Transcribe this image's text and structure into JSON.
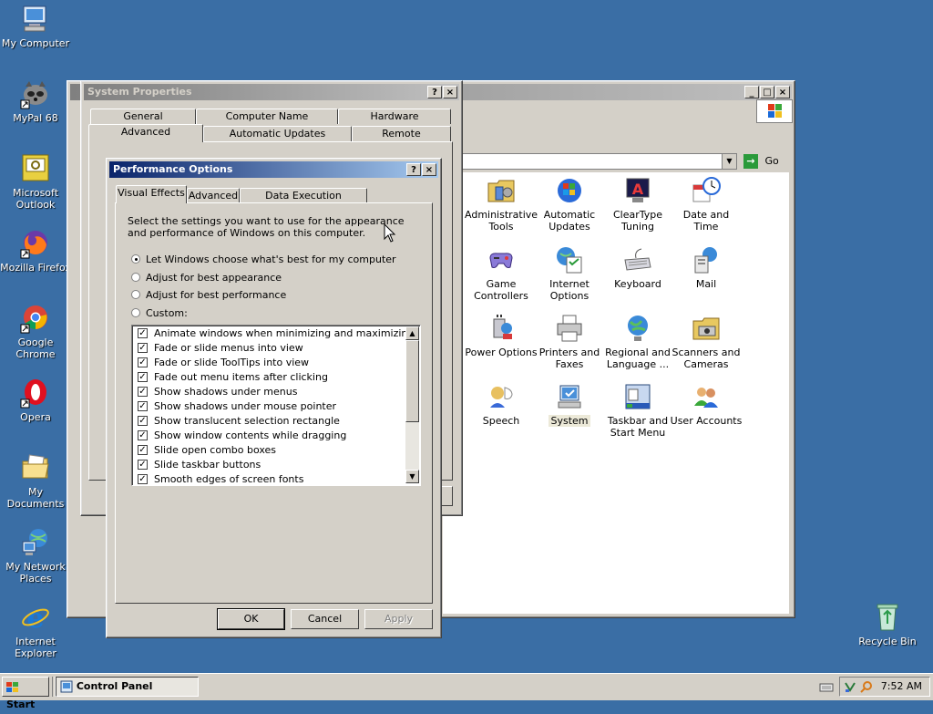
{
  "desktop": {
    "icons": [
      {
        "label": "My Computer"
      },
      {
        "label": "MyPal 68"
      },
      {
        "label": "Microsoft Outlook"
      },
      {
        "label": "Mozilla Firefox"
      },
      {
        "label": "Google Chrome"
      },
      {
        "label": "Opera"
      },
      {
        "label": "My Documents"
      },
      {
        "label": "My Network Places"
      },
      {
        "label": "Internet Explorer"
      },
      {
        "label": "Recycle Bin"
      }
    ]
  },
  "control_panel": {
    "title": "Control Panel",
    "go_label": "Go",
    "items": [
      {
        "label": "Administrative Tools",
        "icon": "admin-tools-icon"
      },
      {
        "label": "Automatic Updates",
        "icon": "auto-updates-icon"
      },
      {
        "label": "ClearType Tuning",
        "icon": "cleartype-icon"
      },
      {
        "label": "Date and Time",
        "icon": "clock-icon"
      },
      {
        "label": "Game Controllers",
        "icon": "gamepad-icon"
      },
      {
        "label": "Internet Options",
        "icon": "internet-options-icon"
      },
      {
        "label": "Keyboard",
        "icon": "keyboard-icon"
      },
      {
        "label": "Mail",
        "icon": "mail-icon"
      },
      {
        "label": "Power Options",
        "icon": "power-icon"
      },
      {
        "label": "Printers and Faxes",
        "icon": "printer-icon"
      },
      {
        "label": "Regional and Language ...",
        "icon": "globe-icon"
      },
      {
        "label": "Scanners and Cameras",
        "icon": "scanner-icon"
      },
      {
        "label": "Speech",
        "icon": "speech-icon"
      },
      {
        "label": "System",
        "icon": "system-icon"
      },
      {
        "label": "Taskbar and Start Menu",
        "icon": "taskbar-icon"
      },
      {
        "label": "User Accounts",
        "icon": "users-icon"
      }
    ]
  },
  "system_properties": {
    "title": "System Properties",
    "tabs_row1": [
      "General",
      "Computer Name",
      "Hardware"
    ],
    "tabs_row2": [
      "Advanced",
      "Automatic Updates",
      "Remote"
    ]
  },
  "performance_options": {
    "title": "Performance Options",
    "tabs": [
      "Visual Effects",
      "Advanced",
      "Data Execution Prevention"
    ],
    "description": "Select the settings you want to use for the appearance and performance of Windows on this computer.",
    "radios": [
      {
        "label": "Let Windows choose what's best for my computer",
        "selected": true
      },
      {
        "label": "Adjust for best appearance",
        "selected": false
      },
      {
        "label": "Adjust for best performance",
        "selected": false
      },
      {
        "label": "Custom:",
        "selected": false
      }
    ],
    "effects": [
      "Animate windows when minimizing and maximizing",
      "Fade or slide menus into view",
      "Fade or slide ToolTips into view",
      "Fade out menu items after clicking",
      "Show shadows under menus",
      "Show shadows under mouse pointer",
      "Show translucent selection rectangle",
      "Show window contents while dragging",
      "Slide open combo boxes",
      "Slide taskbar buttons",
      "Smooth edges of screen fonts"
    ],
    "ok_label": "OK",
    "cancel_label": "Cancel",
    "apply_label": "Apply"
  },
  "taskbar": {
    "start_label": "Start",
    "task_label": "Control Panel",
    "clock": "7:52 AM"
  }
}
